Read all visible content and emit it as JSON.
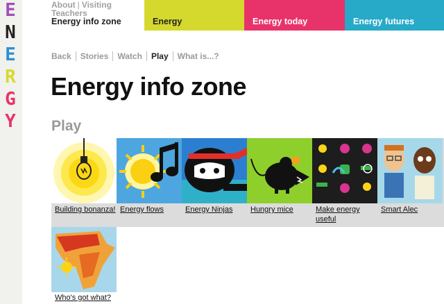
{
  "logo": {
    "letters": [
      "E",
      "N",
      "E",
      "R",
      "G",
      "Y"
    ],
    "colors": [
      "#a24fb5",
      "#222222",
      "#2d8fd2",
      "#d6d92d",
      "#e8336a",
      "#e8336a"
    ]
  },
  "top_nav": {
    "about": "About",
    "visiting": "Visiting",
    "teachers": "Teachers",
    "zone": "Energy info zone",
    "tabs": [
      {
        "label": "Energy",
        "color": "#d6d92d"
      },
      {
        "label": "Energy today",
        "color": "#e8336a"
      },
      {
        "label": "Energy futures",
        "color": "#27a9c8"
      }
    ]
  },
  "sub_nav": [
    "Back",
    "Stories",
    "Watch",
    "Play",
    "What is...?"
  ],
  "sub_nav_active": "Play",
  "page_title": "Energy info zone",
  "section_title": "Play",
  "games": [
    {
      "label": "Building bonanza!",
      "icon": "lightbulb-icon"
    },
    {
      "label": "Energy flows",
      "icon": "sun-music-icon"
    },
    {
      "label": "Energy Ninjas",
      "icon": "ninja-icon"
    },
    {
      "label": "Hungry mice",
      "icon": "mouse-icon"
    },
    {
      "label": "Make energy useful",
      "icon": "energy-symbols-icon"
    },
    {
      "label": "Smart Alec",
      "icon": "people-icon"
    },
    {
      "label": "Who's got what?",
      "icon": "africa-map-icon"
    }
  ]
}
